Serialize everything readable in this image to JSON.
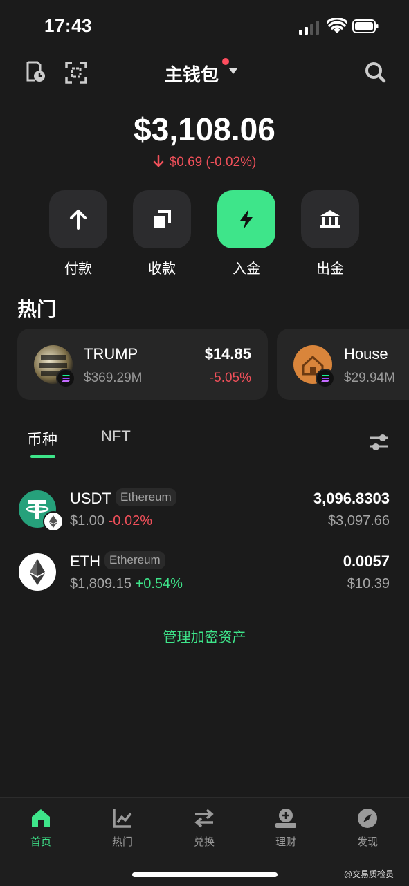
{
  "status_bar": {
    "time": "17:43"
  },
  "header": {
    "title": "主钱包"
  },
  "balance": {
    "total": "$3,108.06",
    "change": "$0.69 (-0.02%)"
  },
  "actions": [
    {
      "label": "付款",
      "icon": "arrow-up-icon"
    },
    {
      "label": "收款",
      "icon": "copy-icon"
    },
    {
      "label": "入金",
      "icon": "lightning-icon"
    },
    {
      "label": "出金",
      "icon": "bank-icon"
    }
  ],
  "hot": {
    "title": "热门",
    "cards": [
      {
        "name": "TRUMP",
        "market_cap": "$369.29M",
        "price": "$14.85",
        "change": "-5.05%"
      },
      {
        "name": "House",
        "market_cap": "$29.94M"
      }
    ]
  },
  "tabs": [
    {
      "label": "币种"
    },
    {
      "label": "NFT"
    }
  ],
  "assets": [
    {
      "symbol": "USDT",
      "chain": "Ethereum",
      "price": "$1.00",
      "change": "-0.02%",
      "amount": "3,096.8303",
      "value": "$3,097.66"
    },
    {
      "symbol": "ETH",
      "chain": "Ethereum",
      "price": "$1,809.15",
      "change": "+0.54%",
      "amount": "0.0057",
      "value": "$10.39"
    }
  ],
  "manage_label": "管理加密资产",
  "nav": [
    {
      "label": "首页",
      "icon": "home-icon"
    },
    {
      "label": "热门",
      "icon": "chart-icon"
    },
    {
      "label": "兑换",
      "icon": "swap-icon"
    },
    {
      "label": "理财",
      "icon": "earn-icon"
    },
    {
      "label": "发现",
      "icon": "compass-icon"
    }
  ],
  "watermark": "@交易质检员",
  "colors": {
    "accent": "#3ee58a",
    "negative": "#f0505a",
    "background": "#1b1b1b"
  }
}
